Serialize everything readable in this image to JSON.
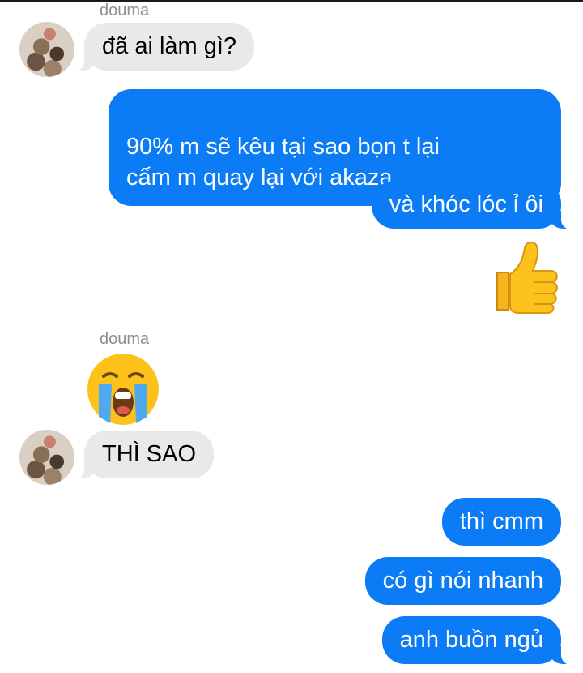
{
  "conversation": {
    "sender_name": "douma",
    "messages": [
      {
        "from": "douma",
        "text": "đã ai làm gì?"
      },
      {
        "from": "me",
        "text": "90% m sẽ kêu tại sao bọn t lại\ncấm m quay lại với akaza"
      },
      {
        "from": "me",
        "text": "và khóc lóc ỉ ôi"
      },
      {
        "from": "me",
        "emoji": "thumbs-up-icon"
      },
      {
        "from": "douma",
        "emoji": "loudly-crying-face-icon"
      },
      {
        "from": "douma",
        "text": "THÌ SAO"
      },
      {
        "from": "me",
        "text": "thì cmm"
      },
      {
        "from": "me",
        "text": "có gì nói nhanh"
      },
      {
        "from": "me",
        "text": "anh buồn ngủ"
      }
    ]
  },
  "colors": {
    "incoming_bubble": "#e9e9eb",
    "outgoing_bubble": "#0b7cf6",
    "sender_label": "#8e8e93"
  }
}
